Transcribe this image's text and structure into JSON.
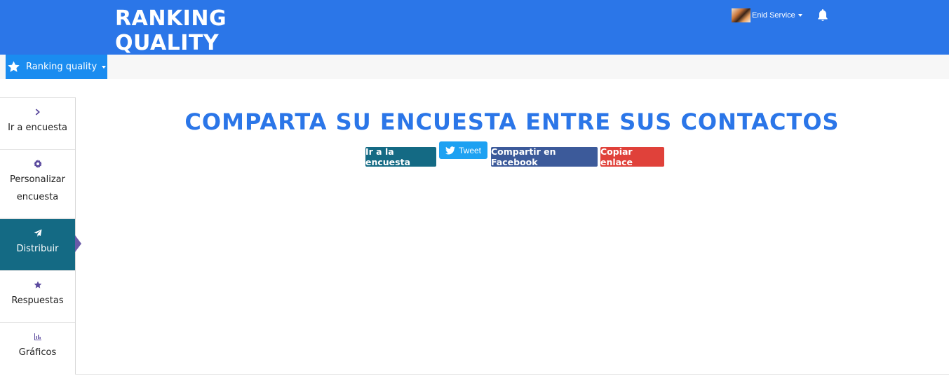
{
  "header": {
    "logo_line1": "RANKING",
    "logo_line2": "QUALITY",
    "user_name": "Enid Service",
    "bell_icon": "bell-icon",
    "bg_color": "#2b76e8"
  },
  "project_tab": {
    "label": "Ranking quality",
    "icon": "star-icon"
  },
  "sidebar": {
    "items": [
      {
        "label": "Ir a encuesta",
        "icon": "chevron-right-icon"
      },
      {
        "label_line1": "Personalizar",
        "label_line2": "encuesta",
        "icon": "gear-icon"
      },
      {
        "label": "Distribuir",
        "icon": "paper-plane-icon",
        "active": true
      },
      {
        "label": "Respuestas",
        "icon": "star-icon"
      },
      {
        "label": "Gráficos",
        "icon": "bar-chart-icon"
      }
    ]
  },
  "main": {
    "headline": "COMPARTA SU ENCUESTA ENTRE SUS CONTACTOS",
    "buttons": {
      "go": "Ir a la encuesta",
      "tweet": "Tweet",
      "facebook": "Compartir en Facebook",
      "copy": "Copiar enlace"
    }
  },
  "colors": {
    "accent": "#2b76e8",
    "active_sidebar": "#146a84",
    "facebook": "#3c5a9a",
    "copy": "#e0413a",
    "twitter": "#1da1f2"
  }
}
